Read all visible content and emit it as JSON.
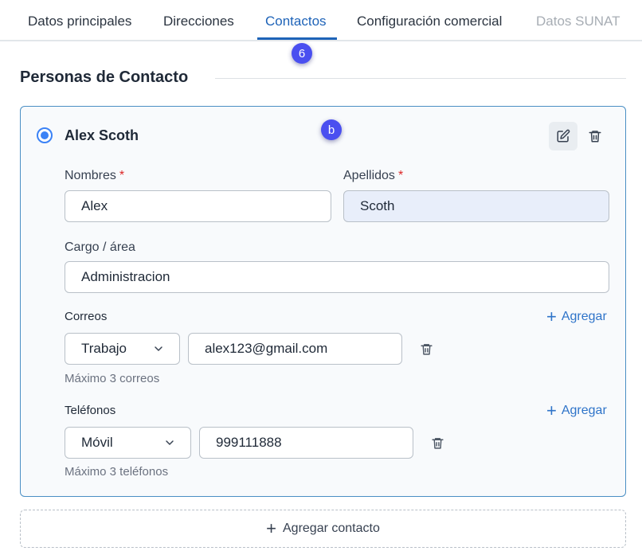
{
  "tabs": [
    {
      "label": "Datos principales",
      "state": "normal"
    },
    {
      "label": "Direcciones",
      "state": "normal"
    },
    {
      "label": "Contactos",
      "state": "active"
    },
    {
      "label": "Configuración comercial",
      "state": "normal"
    },
    {
      "label": "Datos SUNAT",
      "state": "disabled"
    }
  ],
  "markers": {
    "tab_marker": "6",
    "card_marker": "b"
  },
  "section": {
    "title": "Personas de Contacto"
  },
  "contact": {
    "name": "Alex Scoth",
    "selected": true,
    "fields": {
      "nombres_label": "Nombres",
      "nombres_value": "Alex",
      "apellidos_label": "Apellidos",
      "apellidos_value": "Scoth",
      "required_mark": "*",
      "cargo_label": "Cargo / área",
      "cargo_value": "Administracion"
    },
    "emails": {
      "label": "Correos",
      "add_label": "Agregar",
      "items": [
        {
          "type": "Trabajo",
          "value": "alex123@gmail.com"
        }
      ],
      "hint": "Máximo 3 correos"
    },
    "phones": {
      "label": "Teléfonos",
      "add_label": "Agregar",
      "items": [
        {
          "type": "Móvil",
          "value": "999111888"
        }
      ],
      "hint": "Máximo 3 teléfonos"
    }
  },
  "add_contact_label": "Agregar contacto",
  "colors": {
    "accent": "#1e63b8",
    "link": "#2f74c9",
    "required": "#dc2626",
    "marker": "#4a4ff0"
  },
  "icons": {
    "edit": "edit-icon",
    "delete": "trash-icon",
    "chevron": "chevron-down-icon",
    "plus": "plus-icon"
  }
}
